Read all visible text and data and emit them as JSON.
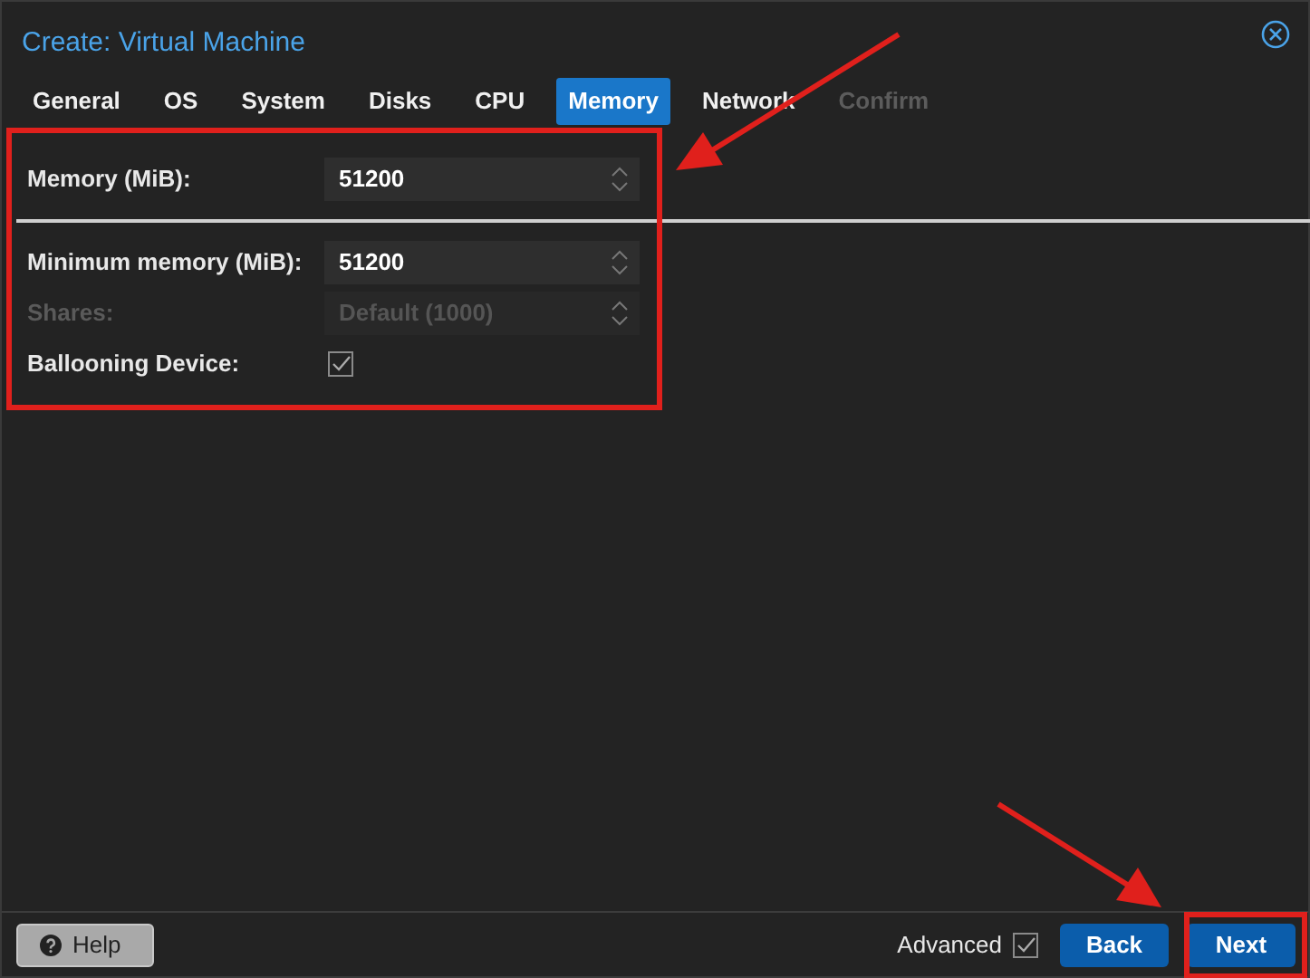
{
  "window": {
    "title": "Create: Virtual Machine"
  },
  "tabs": [
    {
      "label": "General",
      "selected": false,
      "disabled": false
    },
    {
      "label": "OS",
      "selected": false,
      "disabled": false
    },
    {
      "label": "System",
      "selected": false,
      "disabled": false
    },
    {
      "label": "Disks",
      "selected": false,
      "disabled": false
    },
    {
      "label": "CPU",
      "selected": false,
      "disabled": false
    },
    {
      "label": "Memory",
      "selected": true,
      "disabled": false
    },
    {
      "label": "Network",
      "selected": false,
      "disabled": false
    },
    {
      "label": "Confirm",
      "selected": false,
      "disabled": true
    }
  ],
  "fields": [
    {
      "kind": "spinner",
      "label": "Memory (MiB):",
      "value": "51200",
      "disabled": false
    },
    {
      "kind": "separator"
    },
    {
      "kind": "spinner",
      "label": "Minimum memory (MiB):",
      "value": "51200",
      "disabled": false
    },
    {
      "kind": "spinner",
      "label": "Shares:",
      "placeholder": "Default (1000)",
      "disabled": true
    },
    {
      "kind": "checkbox",
      "label": "Ballooning Device:",
      "checked": true,
      "disabled": false
    }
  ],
  "footer": {
    "help": "Help",
    "advanced": {
      "label": "Advanced",
      "checked": true
    },
    "buttons": [
      "Back",
      "Next"
    ]
  }
}
